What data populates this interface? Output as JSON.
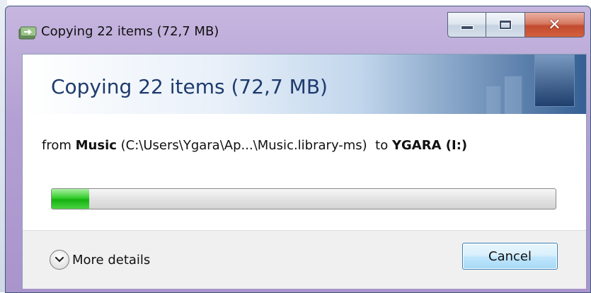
{
  "window": {
    "title": "Copying 22 items (72,7 MB)"
  },
  "dialog": {
    "heading": "Copying 22 items (72,7 MB)",
    "from": {
      "prefix": "from",
      "source_name": "Music",
      "source_path": "(C:\\Users\\Ygara\\Ap...\\Music.library-ms)",
      "to_word": "to",
      "destination": "YGARA (I:)"
    },
    "progress": {
      "fraction": 0.075
    },
    "more_details_label": "More details",
    "cancel_label": "Cancel"
  },
  "colors": {
    "progress_green": "#1fbd18",
    "heading_blue": "#1e3b6e",
    "title_bar": "#b3a0d3"
  },
  "icons": {
    "app": "copy-icon",
    "minimize": "minimize-icon",
    "maximize": "maximize-icon",
    "close": "close-icon",
    "details": "chevron-down-icon"
  }
}
